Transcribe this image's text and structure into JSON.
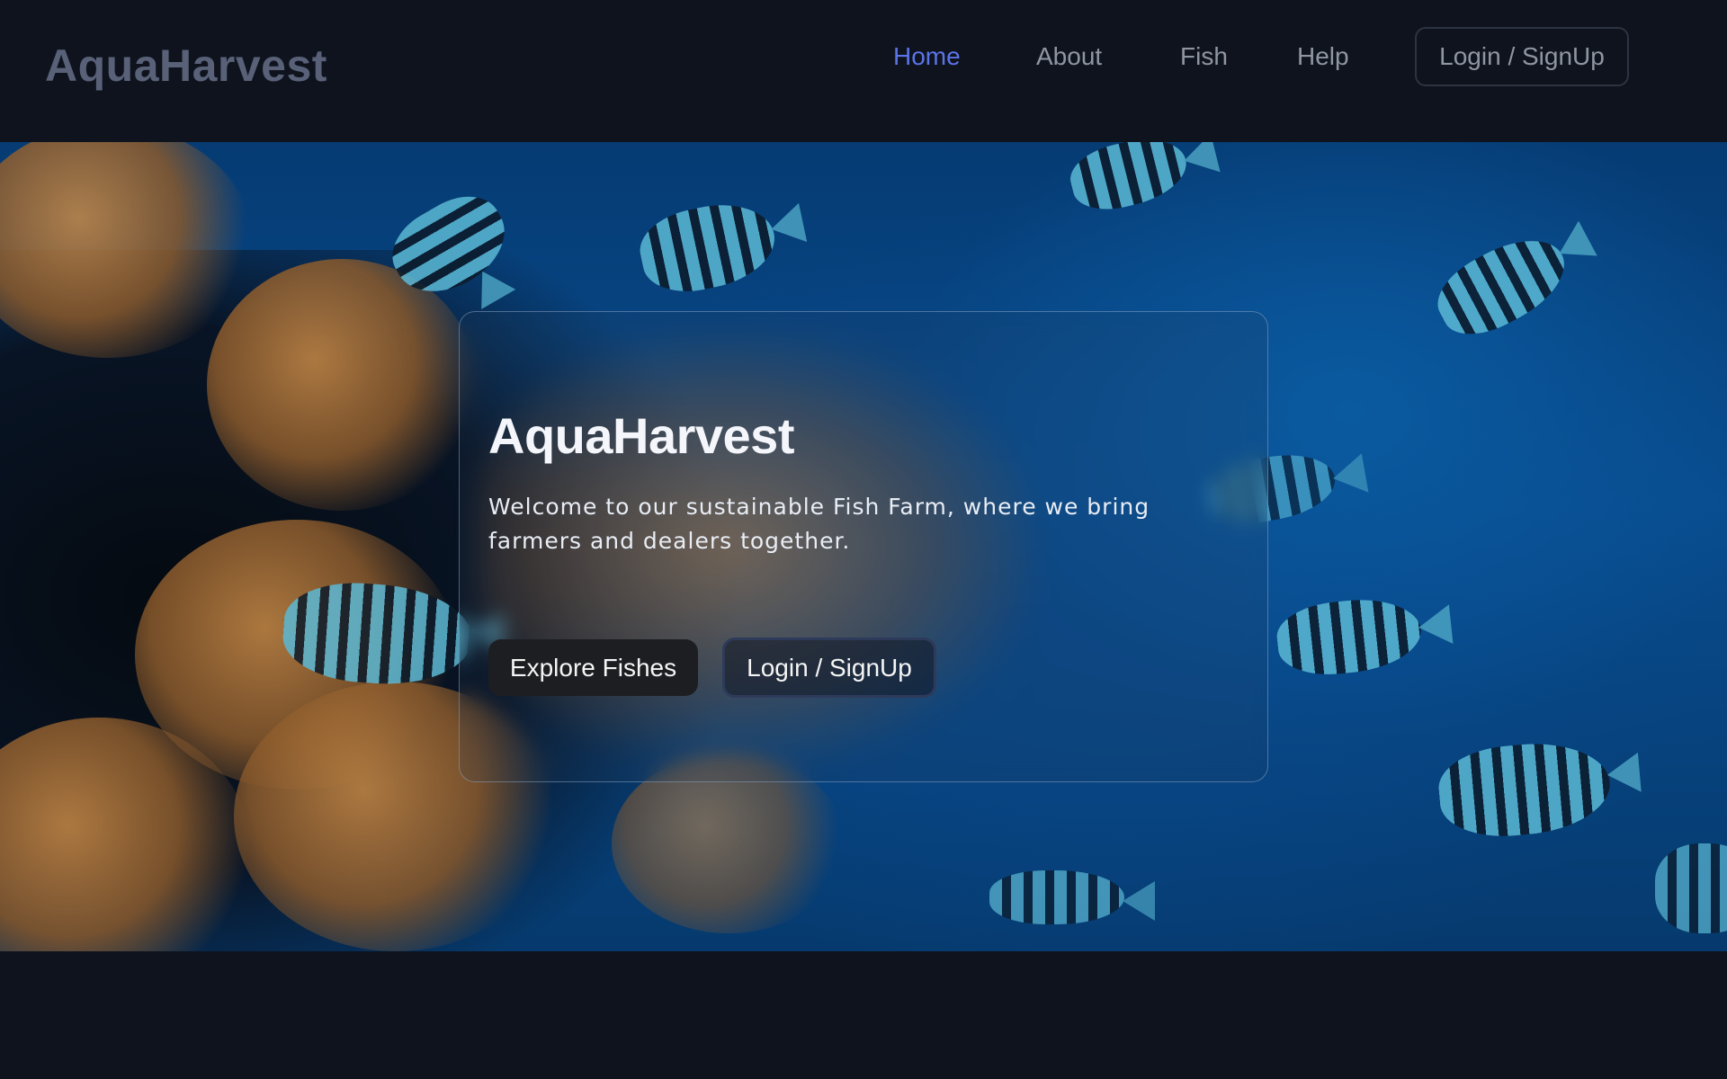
{
  "brand": {
    "name": "AquaHarvest"
  },
  "nav": {
    "items": [
      {
        "label": "Home",
        "active": true
      },
      {
        "label": "About",
        "active": false
      },
      {
        "label": "Fish",
        "active": false
      },
      {
        "label": "Help",
        "active": false
      }
    ],
    "login_label": "Login / SignUp"
  },
  "hero": {
    "title": "AquaHarvest",
    "description": "Welcome to our sustainable Fish Farm, where we bring farmers and dealers together.",
    "primary_button": "Explore Fishes",
    "secondary_button": "Login / SignUp"
  },
  "colors": {
    "background": "#0f131d",
    "accent": "#5b74e6",
    "nav_text": "#8f96a3",
    "logo": "#586178"
  }
}
